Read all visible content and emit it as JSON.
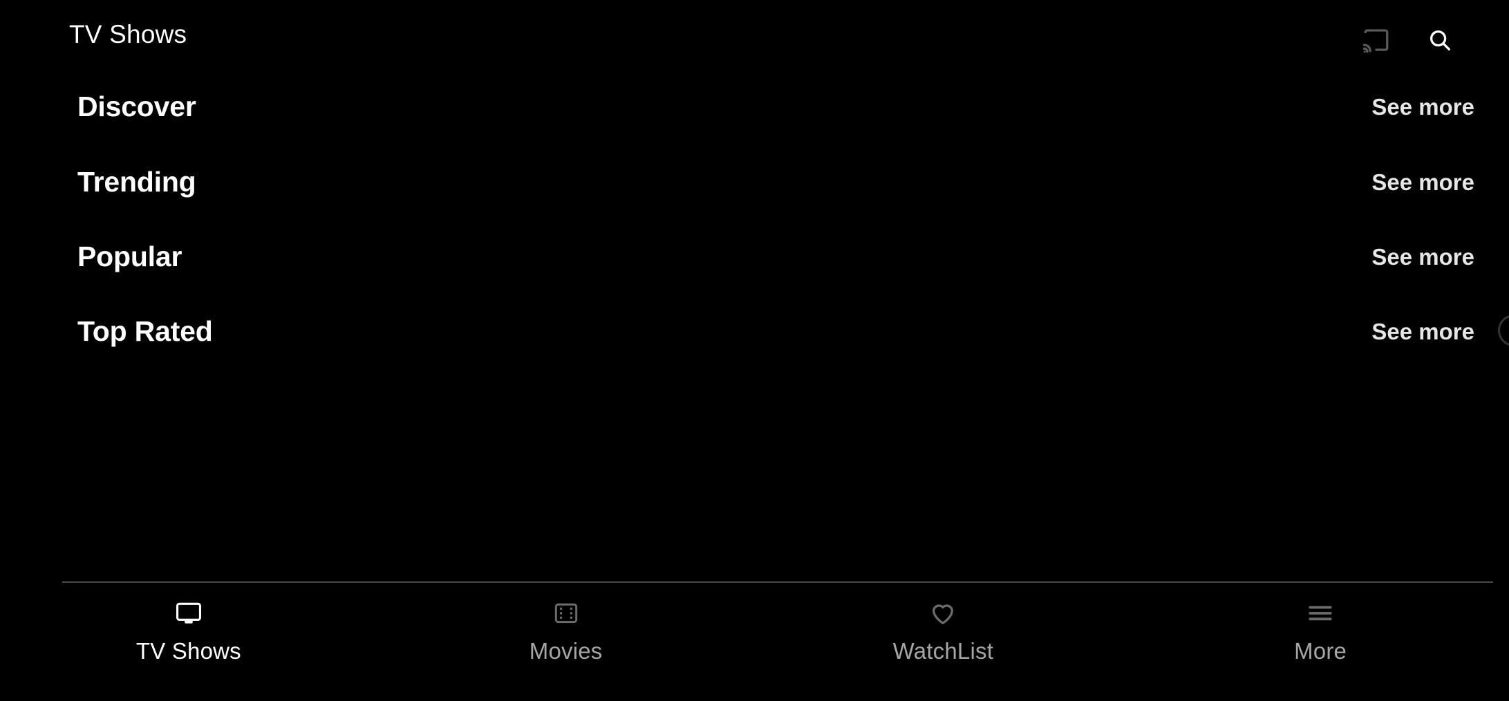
{
  "theme": {
    "background": "#000000",
    "active_color": "#ffffff",
    "inactive_color": "#a6a6a6",
    "icon_inactive_color": "#6b6b6b",
    "divider_color": "#4a4a4a",
    "see_more_color": "#e6e6e6"
  },
  "appbar": {
    "title": "TV Shows",
    "actions": [
      {
        "name": "cast-icon",
        "label": "Cast",
        "color": "#5a5a5a"
      },
      {
        "name": "search-icon",
        "label": "Search",
        "color": "#ffffff"
      }
    ]
  },
  "main": {
    "sections": [
      {
        "title": "Discover",
        "action_label": "See more"
      },
      {
        "title": "Trending",
        "action_label": "See more"
      },
      {
        "title": "Popular",
        "action_label": "See more"
      },
      {
        "title": "Top Rated",
        "action_label": "See more"
      }
    ]
  },
  "bottom_nav": {
    "items": [
      {
        "label": "TV Shows",
        "icon": "tv-icon",
        "active": true
      },
      {
        "label": "Movies",
        "icon": "film-strip-icon",
        "active": false
      },
      {
        "label": "WatchList",
        "icon": "heart-icon",
        "active": false
      },
      {
        "label": "More",
        "icon": "hamburger-menu-icon",
        "active": false
      }
    ]
  }
}
